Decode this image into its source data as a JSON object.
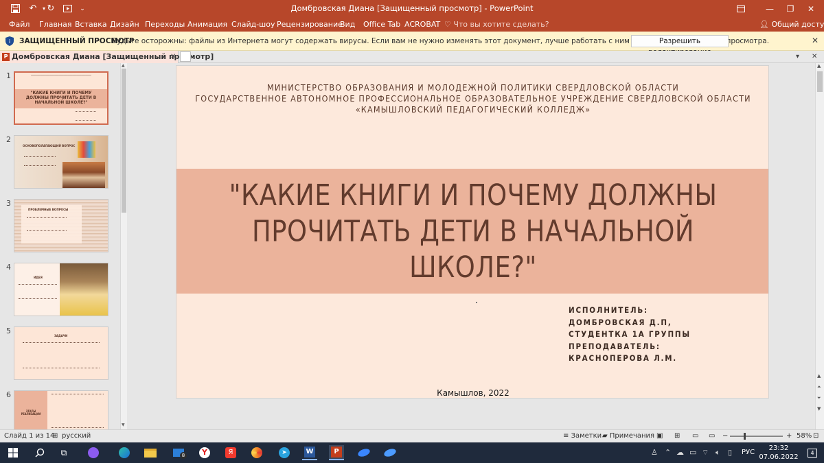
{
  "titlebar": {
    "title": "Домбровская Диана [Защищенный просмотр] - PowerPoint",
    "icons": [
      "save-icon",
      "undo-icon",
      "redo-icon",
      "start-from-beginning-icon",
      "customize-qat-icon"
    ]
  },
  "ribbon": {
    "tabs": [
      "Файл",
      "Главная",
      "Вставка",
      "Дизайн",
      "Переходы",
      "Анимация",
      "Слайд-шоу",
      "Рецензирование",
      "Вид",
      "Office Tab",
      "ACROBAT"
    ],
    "tell_me": "Что вы хотите сделать?",
    "share": "Общий доступ"
  },
  "protected_view": {
    "label": "ЗАЩИЩЕННЫЙ ПРОСМОТР",
    "message": "Будьте осторожны: файлы из Интернета могут содержать вирусы. Если вам не нужно изменять этот документ, лучше работать с ним в режиме защищенного просмотра.",
    "enable_button": "Разрешить редактирование"
  },
  "doc_tab": {
    "label": "Домбровская Диана [Защищенный просмотр]",
    "icon_letter": "P"
  },
  "thumbnails": [
    {
      "number": "1",
      "text": "\"КАКИЕ КНИГИ И ПОЧЕМУ ДОЛЖНЫ ПРОЧИТАТЬ ДЕТИ В НАЧАЛЬНОЙ ШКОЛЕ?\""
    },
    {
      "number": "2",
      "text": "ОСНОВОПОЛАГАЮЩИЙ ВОПРОС"
    },
    {
      "number": "3",
      "text": "ПРОБЛЕМНЫЕ ВОПРОСЫ"
    },
    {
      "number": "4",
      "text": "ИДЕЯ"
    },
    {
      "number": "5",
      "text": "ЗАДАЧИ"
    },
    {
      "number": "6",
      "text": "ЭТАПЫ РЕАЛИЗАЦИИ"
    }
  ],
  "slide": {
    "header_lines": [
      "МИНИСТЕРСТВО ОБРАЗОВАНИЯ И МОЛОДЕЖНОЙ ПОЛИТИКИ СВЕРДЛОВСКОЙ ОБЛАСТИ",
      "ГОСУДАРСТВЕННОЕ АВТОНОМНОЕ ПРОФЕССИОНАЛЬНОЕ ОБРАЗОВАТЕЛЬНОЕ УЧРЕЖДЕНИЕ СВЕРДЛОВСКОЙ ОБЛАСТИ",
      "«КАМЫШЛОВСКИЙ ПЕДАГОГИЧЕСКИЙ КОЛЛЕДЖ»"
    ],
    "title_lines": [
      "\"КАКИЕ КНИГИ И ПОЧЕМУ ДОЛЖНЫ",
      "ПРОЧИТАТЬ ДЕТИ В НАЧАЛЬНОЙ",
      "ШКОЛЕ?\""
    ],
    "author_lines": [
      "ИСПОЛНИТЕЛЬ:",
      "ДОМБРОВСКАЯ Д.П,",
      "СТУДЕНТКА 1А ГРУППЫ",
      "ПРЕПОДАВАТЕЛЬ:",
      "КРАСНОПЕРОВА Л.М."
    ],
    "city": "Камышлов, 2022"
  },
  "status": {
    "slide_info": "Слайд 1 из 14",
    "language": "русский",
    "notes": "Заметки",
    "comments": "Примечания",
    "zoom": "58%"
  },
  "taskbar": {
    "language": "РУС",
    "time": "23:32",
    "date": "07.06.2022",
    "notification_count": "4",
    "mail_badge": "8"
  },
  "colors": {
    "powerpoint_red": "#b7472a",
    "slide_bg": "#fde9dc",
    "title_band": "#ebb39b",
    "title_text": "#623b2d",
    "warning_bar": "#fff4ce"
  }
}
